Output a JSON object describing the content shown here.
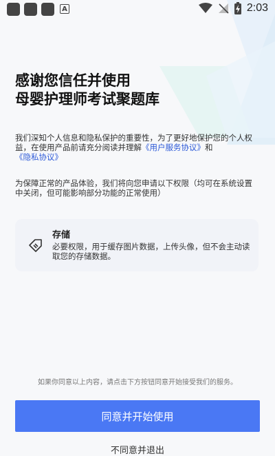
{
  "status_bar": {
    "time": "2:03",
    "notification_letter": "A"
  },
  "title": {
    "line1": "感谢您信任并使用",
    "line2": "母婴护理师考试聚题库"
  },
  "intro": {
    "text": "我们深知个人信息和隐私保护的重要性，为了更好地保护您的个人权益，在使用产品前请充分阅读并理解",
    "user_agreement_link": "《用户服务协议》",
    "and": "和",
    "privacy_link": "《隐私协议》"
  },
  "permissions_intro": "为保障正常的产品体验，我们将向您申请以下权限（均可在系统设置中关闭，但可能影响部分功能的正常使用）",
  "permission": {
    "name": "存储",
    "description": "必要权限，用于缓存图片数据，上传头像，但不会主动读取您的存储数据。",
    "icon": "tag-icon"
  },
  "footer_note": "如果你同意以上内容，请点击下方按钮同意开始接受我们的服务。",
  "agree_button": "同意并开始使用",
  "disagree_link": "不同意并退出",
  "colors": {
    "accent": "#4a78f4",
    "link": "#2f5bd8",
    "deco": "#e6f2f9"
  }
}
